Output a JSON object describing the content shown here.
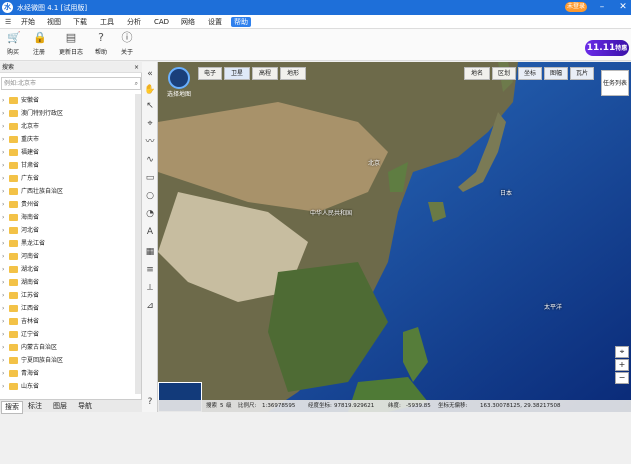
{
  "app": {
    "title": "水经微图 4.1 [试用版]",
    "login": "未登录"
  },
  "menu": [
    "开始",
    "视图",
    "下载",
    "工具",
    "分析",
    "CAD",
    "网络",
    "设置",
    "帮助"
  ],
  "menu_active": "帮助",
  "toolbar": [
    {
      "label": "购买",
      "icon": "cart-icon"
    },
    {
      "label": "注册",
      "icon": "lock-icon"
    },
    {
      "label": "更新日志",
      "icon": "log-icon"
    },
    {
      "label": "帮助",
      "icon": "help-icon"
    },
    {
      "label": "关于",
      "icon": "info-icon"
    }
  ],
  "badge": {
    "main": "11.11",
    "sub": "特惠"
  },
  "panel": {
    "header": "搜索",
    "search_placeholder": "例如:北京市"
  },
  "tree": [
    "安徽省",
    "澳门特别行政区",
    "北京市",
    "重庆市",
    "福建省",
    "甘肃省",
    "广东省",
    "广西壮族自治区",
    "贵州省",
    "海南省",
    "河北省",
    "黑龙江省",
    "河南省",
    "湖北省",
    "湖南省",
    "江苏省",
    "江西省",
    "吉林省",
    "辽宁省",
    "内蒙古自治区",
    "宁夏回族自治区",
    "青海省",
    "山东省"
  ],
  "bottom_tabs": [
    "搜索",
    "标注",
    "图层",
    "导航"
  ],
  "map": {
    "logo_label": "选择地图",
    "modes": [
      "电子",
      "卫星",
      "高程",
      "地形"
    ],
    "layers": [
      "地名",
      "区划",
      "坐标",
      "图幅",
      "瓦片"
    ],
    "task_list": "任务列表",
    "labels": [
      "北京",
      "中华人民共和国",
      "日本",
      "太平洋"
    ]
  },
  "status": {
    "search": "搜索",
    "level_label": "级",
    "level": "5",
    "scale_label": "比例尺:",
    "scale": "1:36978595",
    "lng_label": "经度坐标:",
    "lng": "97819.929621",
    "lat_label": "纬度:",
    "lat": "-5939.85",
    "coord_label": "坐标无偏移:",
    "coord": "163.30078125, 29.38217508"
  }
}
